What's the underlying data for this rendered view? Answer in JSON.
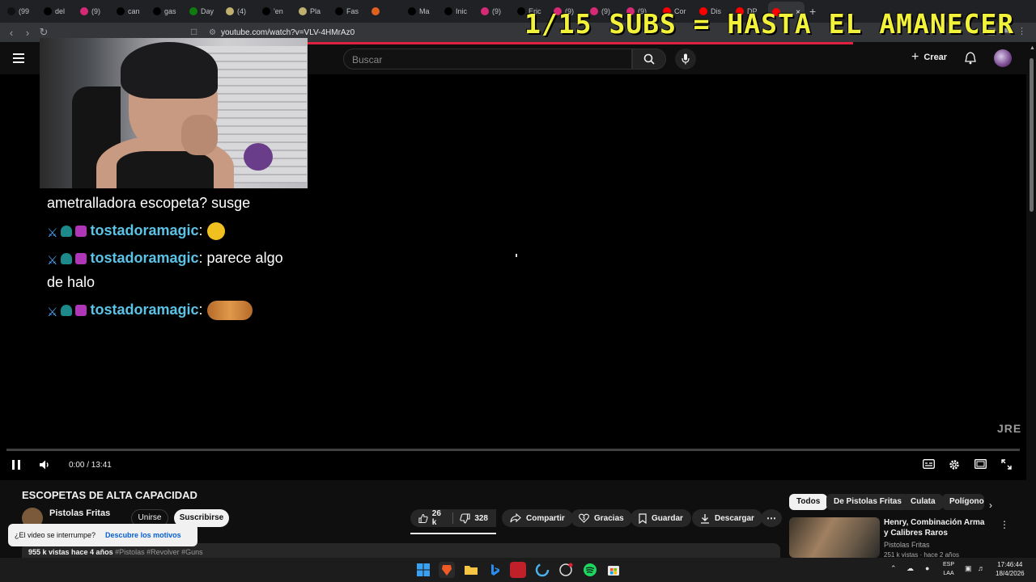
{
  "browser": {
    "tabs": [
      {
        "label": "(99",
        "color": "#111111"
      },
      {
        "label": "del",
        "color": "#000000"
      },
      {
        "label": "(9)",
        "color": "#d62976"
      },
      {
        "label": "can",
        "color": "#000000"
      },
      {
        "label": "gas",
        "color": "#000000"
      },
      {
        "label": "Day",
        "color": "#107c10"
      },
      {
        "label": "(4)",
        "color": "#c0b070"
      },
      {
        "label": "'en",
        "color": "#000000"
      },
      {
        "label": "Pla",
        "color": "#c0b070"
      },
      {
        "label": "Fas",
        "color": "#000000"
      },
      {
        "label": "",
        "color": "#e06020"
      },
      {
        "label": "Ma",
        "color": "#000000"
      },
      {
        "label": "Inic",
        "color": "#000000"
      },
      {
        "label": "(9)",
        "color": "#d62976"
      },
      {
        "label": "Eric",
        "color": "#000000"
      },
      {
        "label": "(9)",
        "color": "#d62976"
      },
      {
        "label": "(9)",
        "color": "#d62976"
      },
      {
        "label": "(9)",
        "color": "#d62976"
      },
      {
        "label": "Cor",
        "color": "#ff0000"
      },
      {
        "label": "Dis",
        "color": "#ff0000"
      },
      {
        "label": "DP",
        "color": "#ff0000"
      },
      {
        "label": "",
        "color": "#ff0000",
        "active": true
      }
    ],
    "url": "youtube.com/watch?v=VLV-4HMrAz0"
  },
  "overlay": {
    "banner": "1/15 SUBS = HASTA EL AMANECER",
    "chat": [
      {
        "type": "text",
        "text": "ametralladora escopeta? susge"
      },
      {
        "type": "msg",
        "user": "tostadoramagic",
        "text": "",
        "emote": "yellow"
      },
      {
        "type": "msg",
        "user": "tostadoramagic",
        "text": "parece algo de halo",
        "emote": ""
      },
      {
        "type": "msg",
        "user": "tostadoramagic",
        "text": "",
        "emote": "cat"
      }
    ],
    "watermark": "JRE"
  },
  "youtube": {
    "search_placeholder": "Buscar",
    "create_label": "Crear",
    "player": {
      "time": "0:00 / 13:41",
      "progress": 0
    },
    "video_title": "ESCOPETAS DE ALTA CAPACIDAD",
    "channel_name": "Pistolas Fritas",
    "join_label": "Unirse",
    "subscribe_label": "Suscribirse",
    "likes": "26 k",
    "dislikes": "328",
    "share_label": "Compartir",
    "thanks_label": "Gracias",
    "save_label": "Guardar",
    "download_label": "Descargar",
    "toast_text": "¿El video se interrumpe?",
    "toast_link": "Descubre los motivos",
    "description_stats": "955 k vistas  hace 4 años",
    "description_tags": "#Pistolas #Revolver #Guns",
    "chips": [
      "Todos",
      "De Pistolas Fritas",
      "Culata",
      "Polígono"
    ],
    "recommendation": {
      "title": "Henry, Combinación Arma y Calibres Raros",
      "channel": "Pistolas Fritas",
      "meta": "251 k vistas · hace 2 años"
    }
  },
  "taskbar": {
    "language": "ESP",
    "language_sub": "LAA",
    "time": "17:46:44",
    "date": "18/4/2026"
  },
  "colors": {
    "banner": "#f2f23a",
    "accent_red": "#e02040",
    "username": "#5bc3e6"
  }
}
